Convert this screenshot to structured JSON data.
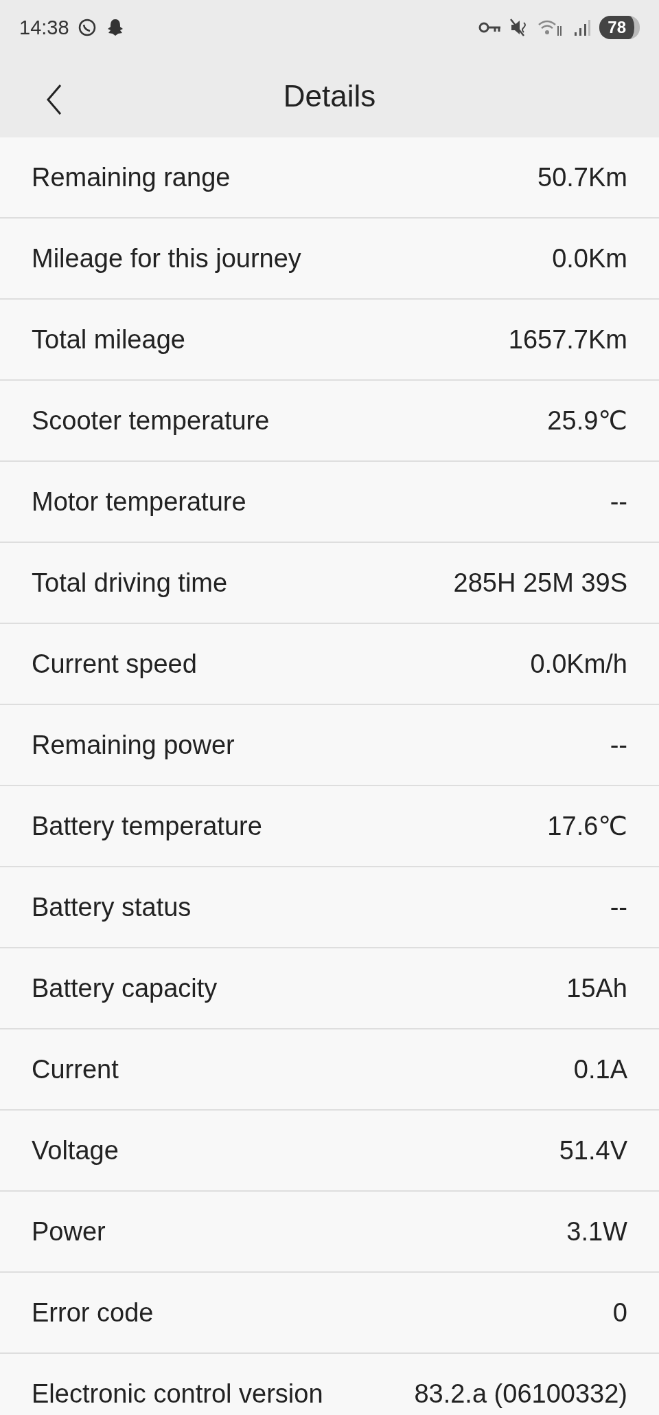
{
  "status_bar": {
    "time": "14:38",
    "battery": "78"
  },
  "header": {
    "title": "Details"
  },
  "rows": [
    {
      "label": "Remaining range",
      "value": "50.7Km"
    },
    {
      "label": "Mileage for this journey",
      "value": "0.0Km"
    },
    {
      "label": "Total mileage",
      "value": "1657.7Km"
    },
    {
      "label": "Scooter temperature",
      "value": "25.9℃"
    },
    {
      "label": "Motor temperature",
      "value": "--"
    },
    {
      "label": "Total driving time",
      "value": "285H 25M 39S"
    },
    {
      "label": "Current speed",
      "value": "0.0Km/h"
    },
    {
      "label": "Remaining power",
      "value": "--"
    },
    {
      "label": "Battery temperature",
      "value": "17.6℃"
    },
    {
      "label": "Battery status",
      "value": "--"
    },
    {
      "label": "Battery capacity",
      "value": "15Ah"
    },
    {
      "label": "Current",
      "value": "0.1A"
    },
    {
      "label": "Voltage",
      "value": "51.4V"
    },
    {
      "label": "Power",
      "value": "3.1W"
    },
    {
      "label": "Error code",
      "value": "0"
    },
    {
      "label": "Electronic control version",
      "value": "83.2.a (06100332)"
    }
  ]
}
